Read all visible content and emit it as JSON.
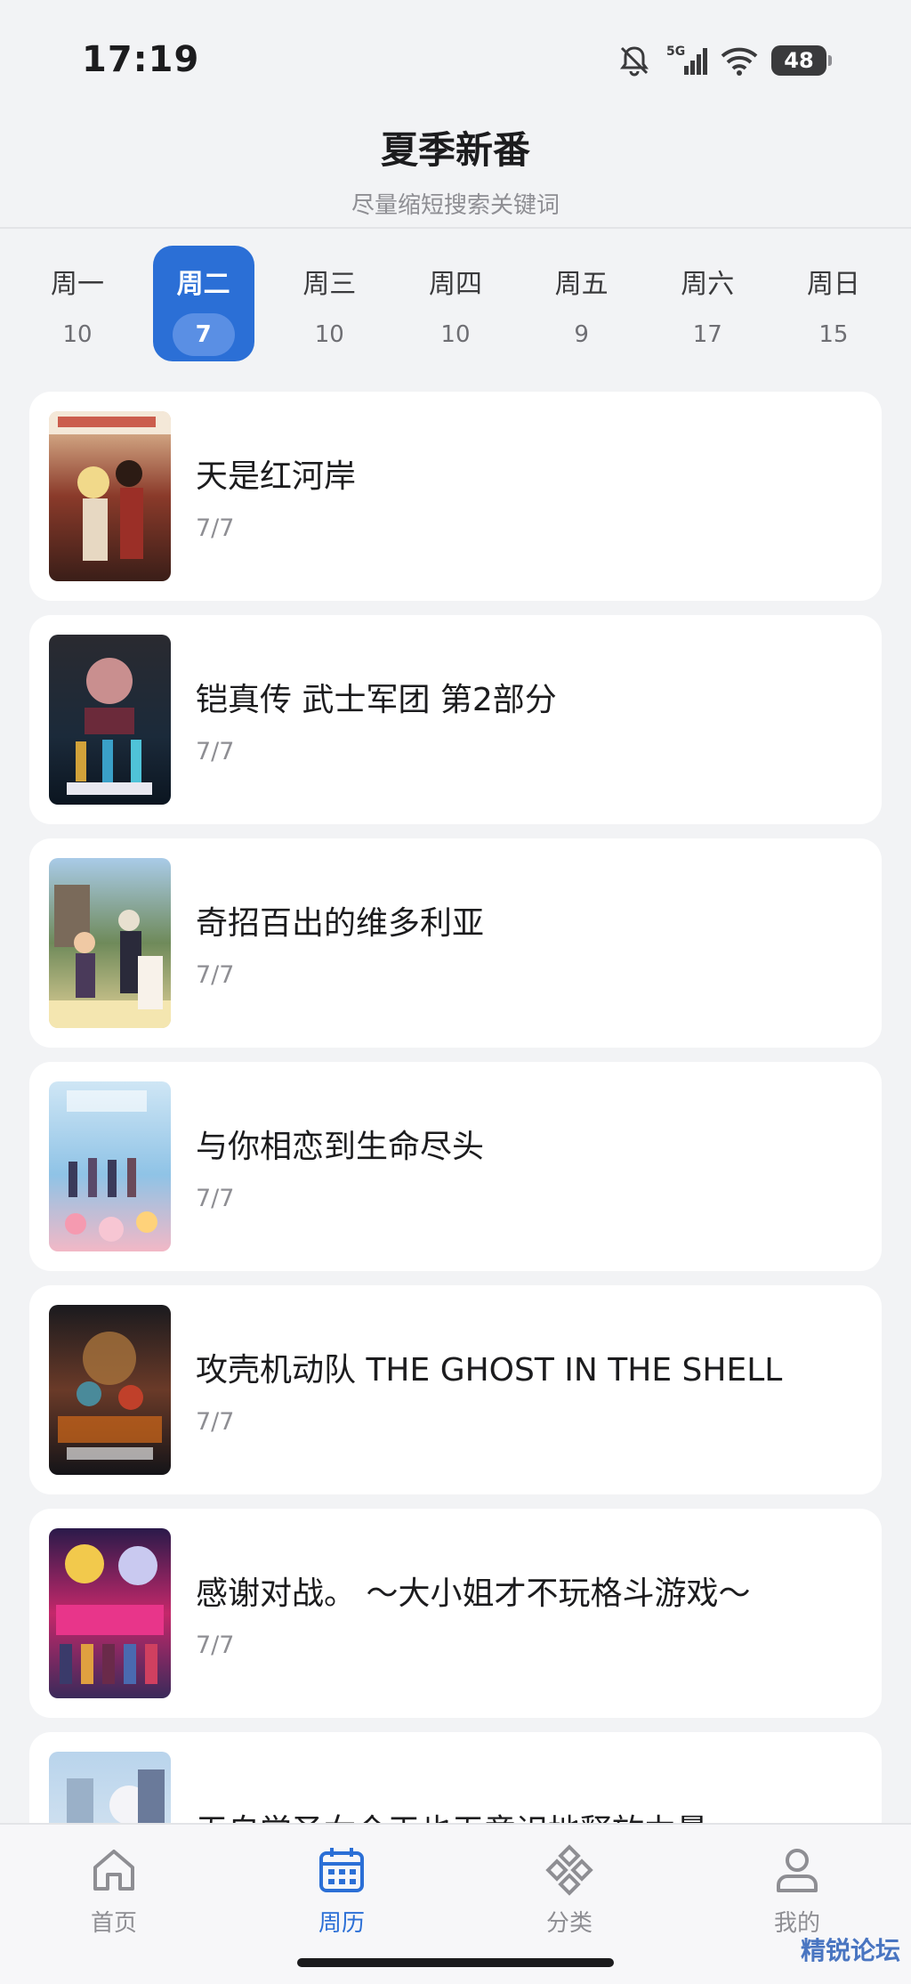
{
  "status_bar": {
    "time": "17:19",
    "network": "5G",
    "battery": "48"
  },
  "header": {
    "title": "夏季新番",
    "subtitle": "尽量缩短搜索关键词"
  },
  "days": [
    {
      "name": "周一",
      "count": "10"
    },
    {
      "name": "周二",
      "count": "7"
    },
    {
      "name": "周三",
      "count": "10"
    },
    {
      "name": "周四",
      "count": "10"
    },
    {
      "name": "周五",
      "count": "9"
    },
    {
      "name": "周六",
      "count": "17"
    },
    {
      "name": "周日",
      "count": "15"
    }
  ],
  "active_day": "周二",
  "anime": [
    {
      "title": "天是红河岸",
      "episode": "7/7"
    },
    {
      "title": "铠真传 武士军团 第2部分",
      "episode": "7/7"
    },
    {
      "title": "奇招百出的维多利亚",
      "episode": "7/7"
    },
    {
      "title": "与你相恋到生命尽头",
      "episode": "7/7"
    },
    {
      "title": "攻壳机动队 THE GHOST IN THE SHELL",
      "episode": "7/7"
    },
    {
      "title": "感谢对战。 ～大小姐才不玩格斗游戏～",
      "episode": "7/7"
    },
    {
      "title": "无自觉圣女今天也无意识地释放力量",
      "episode": ""
    }
  ],
  "nav": {
    "home": "首页",
    "calendar": "周历",
    "category": "分类",
    "mine": "我的"
  },
  "watermark": "精锐论坛",
  "colors": {
    "accent": "#2b6fd6",
    "background": "#f2f3f5",
    "card": "#ffffff"
  }
}
